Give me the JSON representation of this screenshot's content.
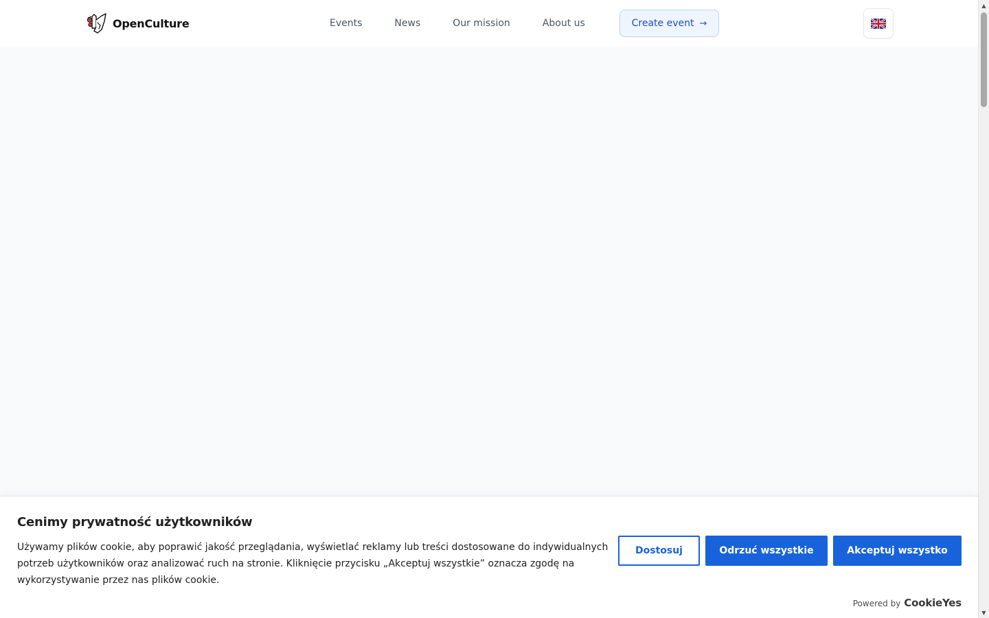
{
  "header": {
    "logo_text": "OpenCulture",
    "nav": [
      {
        "label": "Events"
      },
      {
        "label": "News"
      },
      {
        "label": "Our mission"
      },
      {
        "label": "About us"
      }
    ],
    "create_event_label": "Create event",
    "create_event_icon": "arrow-right-icon",
    "language_icon": "uk-flag-icon",
    "accent_color": "#1d4fbf"
  },
  "cookie_banner": {
    "title": "Cenimy prywatność użytkowników",
    "text": "Używamy plików cookie, aby poprawić jakość przeglądania, wyświetlać reklamy lub treści dostosowane do indywidualnych potrzeb użytkowników oraz analizować ruch na stronie. Kliknięcie przycisku „Akceptuj wszystkie” oznacza zgodę na wykorzystywanie przez nas plików cookie.",
    "customize_label": "Dostosuj",
    "reject_label": "Odrzuć wszystkie",
    "accept_label": "Akceptuj wszystko",
    "powered_by_label": "Powered by",
    "powered_by_brand": "CookieYes",
    "button_color": "#1863dc"
  }
}
